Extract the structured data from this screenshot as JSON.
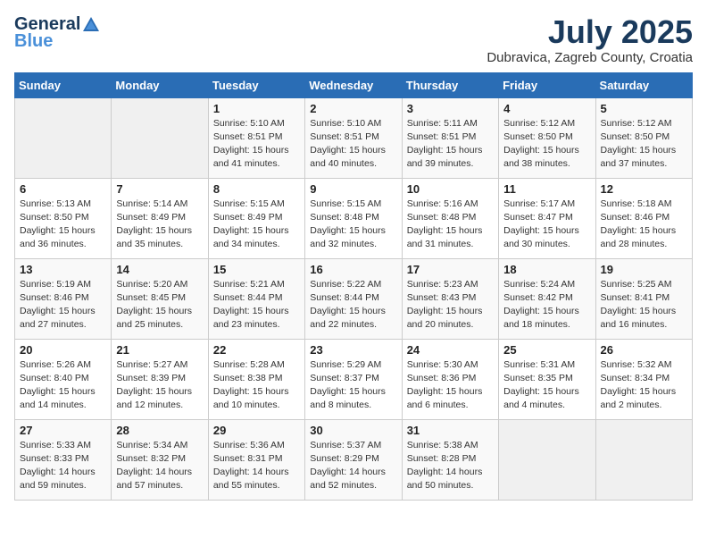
{
  "logo": {
    "general": "General",
    "blue": "Blue"
  },
  "title": "July 2025",
  "location": "Dubravica, Zagreb County, Croatia",
  "days_of_week": [
    "Sunday",
    "Monday",
    "Tuesday",
    "Wednesday",
    "Thursday",
    "Friday",
    "Saturday"
  ],
  "weeks": [
    [
      {
        "day": "",
        "info": ""
      },
      {
        "day": "",
        "info": ""
      },
      {
        "day": "1",
        "info": "Sunrise: 5:10 AM\nSunset: 8:51 PM\nDaylight: 15 hours and 41 minutes."
      },
      {
        "day": "2",
        "info": "Sunrise: 5:10 AM\nSunset: 8:51 PM\nDaylight: 15 hours and 40 minutes."
      },
      {
        "day": "3",
        "info": "Sunrise: 5:11 AM\nSunset: 8:51 PM\nDaylight: 15 hours and 39 minutes."
      },
      {
        "day": "4",
        "info": "Sunrise: 5:12 AM\nSunset: 8:50 PM\nDaylight: 15 hours and 38 minutes."
      },
      {
        "day": "5",
        "info": "Sunrise: 5:12 AM\nSunset: 8:50 PM\nDaylight: 15 hours and 37 minutes."
      }
    ],
    [
      {
        "day": "6",
        "info": "Sunrise: 5:13 AM\nSunset: 8:50 PM\nDaylight: 15 hours and 36 minutes."
      },
      {
        "day": "7",
        "info": "Sunrise: 5:14 AM\nSunset: 8:49 PM\nDaylight: 15 hours and 35 minutes."
      },
      {
        "day": "8",
        "info": "Sunrise: 5:15 AM\nSunset: 8:49 PM\nDaylight: 15 hours and 34 minutes."
      },
      {
        "day": "9",
        "info": "Sunrise: 5:15 AM\nSunset: 8:48 PM\nDaylight: 15 hours and 32 minutes."
      },
      {
        "day": "10",
        "info": "Sunrise: 5:16 AM\nSunset: 8:48 PM\nDaylight: 15 hours and 31 minutes."
      },
      {
        "day": "11",
        "info": "Sunrise: 5:17 AM\nSunset: 8:47 PM\nDaylight: 15 hours and 30 minutes."
      },
      {
        "day": "12",
        "info": "Sunrise: 5:18 AM\nSunset: 8:46 PM\nDaylight: 15 hours and 28 minutes."
      }
    ],
    [
      {
        "day": "13",
        "info": "Sunrise: 5:19 AM\nSunset: 8:46 PM\nDaylight: 15 hours and 27 minutes."
      },
      {
        "day": "14",
        "info": "Sunrise: 5:20 AM\nSunset: 8:45 PM\nDaylight: 15 hours and 25 minutes."
      },
      {
        "day": "15",
        "info": "Sunrise: 5:21 AM\nSunset: 8:44 PM\nDaylight: 15 hours and 23 minutes."
      },
      {
        "day": "16",
        "info": "Sunrise: 5:22 AM\nSunset: 8:44 PM\nDaylight: 15 hours and 22 minutes."
      },
      {
        "day": "17",
        "info": "Sunrise: 5:23 AM\nSunset: 8:43 PM\nDaylight: 15 hours and 20 minutes."
      },
      {
        "day": "18",
        "info": "Sunrise: 5:24 AM\nSunset: 8:42 PM\nDaylight: 15 hours and 18 minutes."
      },
      {
        "day": "19",
        "info": "Sunrise: 5:25 AM\nSunset: 8:41 PM\nDaylight: 15 hours and 16 minutes."
      }
    ],
    [
      {
        "day": "20",
        "info": "Sunrise: 5:26 AM\nSunset: 8:40 PM\nDaylight: 15 hours and 14 minutes."
      },
      {
        "day": "21",
        "info": "Sunrise: 5:27 AM\nSunset: 8:39 PM\nDaylight: 15 hours and 12 minutes."
      },
      {
        "day": "22",
        "info": "Sunrise: 5:28 AM\nSunset: 8:38 PM\nDaylight: 15 hours and 10 minutes."
      },
      {
        "day": "23",
        "info": "Sunrise: 5:29 AM\nSunset: 8:37 PM\nDaylight: 15 hours and 8 minutes."
      },
      {
        "day": "24",
        "info": "Sunrise: 5:30 AM\nSunset: 8:36 PM\nDaylight: 15 hours and 6 minutes."
      },
      {
        "day": "25",
        "info": "Sunrise: 5:31 AM\nSunset: 8:35 PM\nDaylight: 15 hours and 4 minutes."
      },
      {
        "day": "26",
        "info": "Sunrise: 5:32 AM\nSunset: 8:34 PM\nDaylight: 15 hours and 2 minutes."
      }
    ],
    [
      {
        "day": "27",
        "info": "Sunrise: 5:33 AM\nSunset: 8:33 PM\nDaylight: 14 hours and 59 minutes."
      },
      {
        "day": "28",
        "info": "Sunrise: 5:34 AM\nSunset: 8:32 PM\nDaylight: 14 hours and 57 minutes."
      },
      {
        "day": "29",
        "info": "Sunrise: 5:36 AM\nSunset: 8:31 PM\nDaylight: 14 hours and 55 minutes."
      },
      {
        "day": "30",
        "info": "Sunrise: 5:37 AM\nSunset: 8:29 PM\nDaylight: 14 hours and 52 minutes."
      },
      {
        "day": "31",
        "info": "Sunrise: 5:38 AM\nSunset: 8:28 PM\nDaylight: 14 hours and 50 minutes."
      },
      {
        "day": "",
        "info": ""
      },
      {
        "day": "",
        "info": ""
      }
    ]
  ]
}
